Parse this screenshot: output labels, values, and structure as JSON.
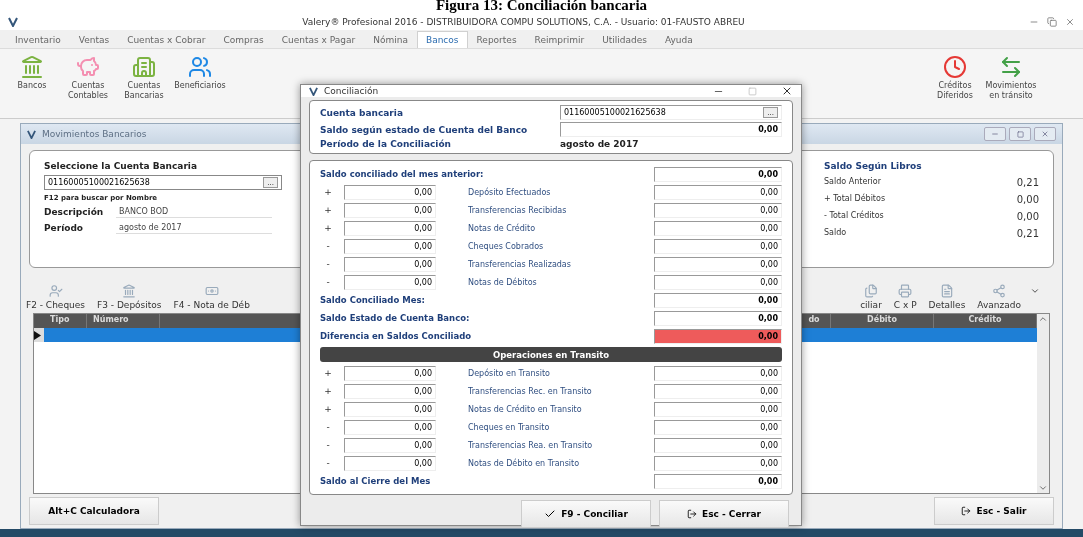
{
  "caption": "Figura 13: Conciliación bancaria",
  "window": {
    "title": "Valery® Profesional 2016 - DISTRIBUIDORA COMPU SOLUTIONS, C.A. - Usuario: 01-FAUSTO ABREU"
  },
  "menu": [
    {
      "label": "Inventario",
      "selected": false
    },
    {
      "label": "Ventas",
      "selected": false
    },
    {
      "label": "Cuentas x Cobrar",
      "selected": false
    },
    {
      "label": "Compras",
      "selected": false
    },
    {
      "label": "Cuentas x Pagar",
      "selected": false
    },
    {
      "label": "Nómina",
      "selected": false
    },
    {
      "label": "Bancos",
      "selected": true
    },
    {
      "label": "Reportes",
      "selected": false
    },
    {
      "label": "Reimprimir",
      "selected": false
    },
    {
      "label": "Utilidades",
      "selected": false
    },
    {
      "label": "Ayuda",
      "selected": false
    }
  ],
  "ribbon": {
    "left": [
      "Bancos",
      "Cuentas Contables",
      "Cuentas Bancarias",
      "Beneficiarios"
    ],
    "right": [
      "Créditos Diferidos",
      "Movimientos en tránsito"
    ]
  },
  "inner_window": {
    "title": "Movimientos Bancarios"
  },
  "account_panel": {
    "title": "Seleccione la Cuenta Bancaria",
    "account": "01160005100021625638",
    "browse": "...",
    "hint": "F12 para buscar por Nombre",
    "fields": [
      {
        "label": "Descripción",
        "value": "BANCO BOD"
      },
      {
        "label": "Período",
        "value": "agosto de 2017"
      }
    ]
  },
  "books_panel": {
    "title": "Saldo Según Libros",
    "rows": [
      {
        "label": "Saldo Anterior",
        "value": "0,21"
      },
      {
        "label": "+ Total Débitos",
        "value": "0,00"
      },
      {
        "label": "- Total Créditos",
        "value": "0,00"
      },
      {
        "label": "Saldo",
        "value": "0,21"
      }
    ]
  },
  "toolbar": {
    "left": [
      "F2 - Cheques",
      "F3 - Depósitos",
      "F4 - Nota de Déb"
    ],
    "right": [
      "ciliar",
      "C x P",
      "Detalles",
      "Avanzado"
    ]
  },
  "table": {
    "columns_left": [
      "Tipo",
      "Número"
    ],
    "columns_right": [
      "do",
      "Débito",
      "Crédito"
    ],
    "rows": [
      {
        "selected": true
      }
    ]
  },
  "buttons": {
    "left": "Alt+C Calculadora",
    "right": "Esc - Salir"
  },
  "dialog": {
    "title": "Conciliación",
    "cuenta": {
      "label": "Cuenta bancaria",
      "value": "01160005100021625638",
      "browse": "..."
    },
    "saldo_banco": {
      "label": "Saldo según estado de Cuenta del Banco",
      "value": "0,00"
    },
    "periodo": {
      "label": "Período de la Conciliación",
      "value": "agosto de 2017"
    },
    "rows": [
      {
        "kind": "total",
        "label": "Saldo conciliado del mes anterior:",
        "value": "0,00",
        "alert": false
      },
      {
        "kind": "item",
        "sign": "+",
        "amount": "0,00",
        "label": "Depósito Efectuados",
        "value": "0,00"
      },
      {
        "kind": "item",
        "sign": "+",
        "amount": "0,00",
        "label": "Transferencias Recibidas",
        "value": "0,00"
      },
      {
        "kind": "item",
        "sign": "+",
        "amount": "0,00",
        "label": "Notas de Crédito",
        "value": "0,00"
      },
      {
        "kind": "item",
        "sign": "-",
        "amount": "0,00",
        "label": "Cheques Cobrados",
        "value": "0,00"
      },
      {
        "kind": "item",
        "sign": "-",
        "amount": "0,00",
        "label": "Transferencias Realizadas",
        "value": "0,00"
      },
      {
        "kind": "item",
        "sign": "-",
        "amount": "0,00",
        "label": "Notas de Débitos",
        "value": "0,00"
      },
      {
        "kind": "total",
        "label": "Saldo Conciliado Mes:",
        "value": "0,00",
        "alert": false
      },
      {
        "kind": "total",
        "label": "Saldo Estado de Cuenta Banco:",
        "value": "0,00",
        "alert": false
      },
      {
        "kind": "total",
        "label": "Diferencia en Saldos Conciliado",
        "value": "0,00",
        "alert": true
      },
      {
        "kind": "heading",
        "label": "Operaciones en Transito"
      },
      {
        "kind": "item",
        "sign": "+",
        "amount": "0,00",
        "label": "Depósito en Transito",
        "value": "0,00"
      },
      {
        "kind": "item",
        "sign": "+",
        "amount": "0,00",
        "label": "Transferencias Rec. en Transito",
        "value": "0,00"
      },
      {
        "kind": "item",
        "sign": "+",
        "amount": "0,00",
        "label": "Notas de Crédito en Transito",
        "value": "0,00"
      },
      {
        "kind": "item",
        "sign": "-",
        "amount": "0,00",
        "label": "Cheques en Transito",
        "value": "0,00"
      },
      {
        "kind": "item",
        "sign": "-",
        "amount": "0,00",
        "label": "Transferencias Rea. en Transito",
        "value": "0,00"
      },
      {
        "kind": "item",
        "sign": "-",
        "amount": "0,00",
        "label": "Notas de Débito en Transito",
        "value": "0,00"
      },
      {
        "kind": "total",
        "label": "Saldo al Cierre del Mes",
        "value": "0,00",
        "alert": false
      }
    ],
    "buttons": [
      "F9 - Conciliar",
      "Esc - Cerrar"
    ]
  }
}
